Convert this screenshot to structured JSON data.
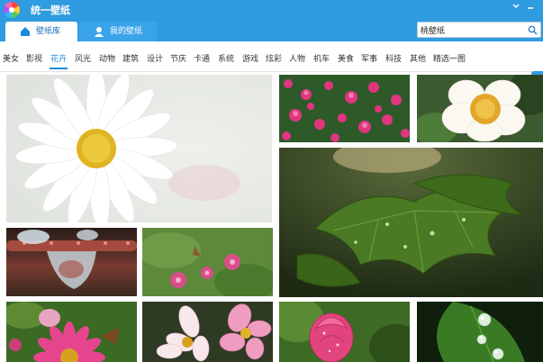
{
  "app": {
    "title": "统一壁纸",
    "tabs": [
      {
        "label": "壁纸库",
        "active": true
      },
      {
        "label": "我的壁纸",
        "active": false
      }
    ],
    "window_controls": [
      "menu-icon",
      "minimize-icon",
      "close-icon"
    ]
  },
  "search": {
    "value": "桃壁纸",
    "icon": "search-icon"
  },
  "categories": {
    "items": [
      "美女",
      "影视",
      "花卉",
      "风光",
      "动物",
      "建筑",
      "设计",
      "节庆",
      "卡通",
      "系统",
      "游戏",
      "炫彩",
      "人物",
      "机车",
      "美食",
      "军事",
      "科技",
      "其他",
      "精选一图"
    ],
    "active": "花卉"
  },
  "thumbnails": [
    {
      "subject": "white daisy"
    },
    {
      "subject": "pink flower field"
    },
    {
      "subject": "white peony"
    },
    {
      "subject": "green leaves with raindrops"
    },
    {
      "subject": "water droplets on stem"
    },
    {
      "subject": "small pink flowers"
    },
    {
      "subject": "pink gerbera and butterfly"
    },
    {
      "subject": "pink and white lilies"
    },
    {
      "subject": "pink rose bud"
    },
    {
      "subject": "dew drops on leaf"
    }
  ],
  "colors": {
    "accent": "#2f9be0",
    "active_category": "#1a8fe0"
  }
}
